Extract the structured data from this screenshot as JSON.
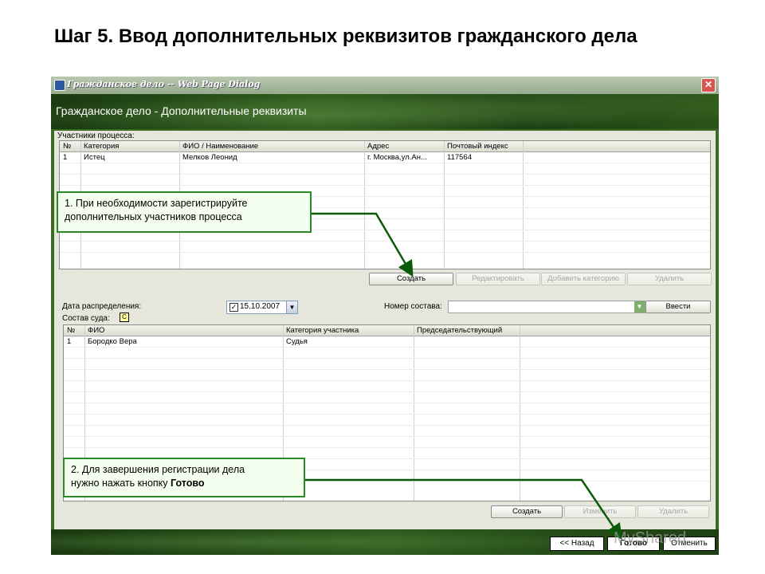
{
  "slide": {
    "title": "Шаг 5. Ввод дополнительных реквизитов гражданского дела"
  },
  "window": {
    "title": "Гражданское дело -- Web Page Dialog",
    "header": "Гражданское дело - Дополнительные реквизиты",
    "close_glyph": "✕"
  },
  "participants": {
    "label": "Участники процесса:",
    "columns": [
      "№",
      "Категория",
      "ФИО / Наименование",
      "Адрес",
      "Почтовый индекс"
    ],
    "rows": [
      [
        "1",
        "Истец",
        "Мелков Леонид",
        "г. Москва,ул.Ан...",
        "117564"
      ]
    ],
    "buttons": {
      "create": "Создать",
      "edit": "Редактировать",
      "add_category": "Добавить категорию",
      "delete": "Удалить"
    }
  },
  "distribution": {
    "date_label": "Дата распределения:",
    "date_checked": "✓",
    "date_value": "15.10.2007",
    "composition_label": "Номер состава:",
    "composition_value": "",
    "enter_button": "Ввести",
    "dropdown_glyph": "▼"
  },
  "court": {
    "label": "Состав суда:",
    "badge": "С",
    "columns": [
      "№",
      "ФИО",
      "Категория участника",
      "Председательствующий"
    ],
    "rows": [
      [
        "1",
        "Бородко Вера",
        "Судья",
        ""
      ]
    ],
    "buttons": {
      "create": "Создать",
      "edit": "Изменить",
      "delete": "Удалить"
    }
  },
  "footer": {
    "back": "<< Назад",
    "done": "Готово",
    "cancel": "Отменить"
  },
  "callouts": {
    "one_line1": "1. При необходимости зарегистрируйте",
    "one_line2": "дополнительных участников процесса",
    "two_line1": "2. Для завершения регистрации дела",
    "two_line2_prefix": "нужно нажать кнопку ",
    "two_line2_bold": "Готово"
  },
  "watermark": "MyShared",
  "colors": {
    "callout_border": "#2a8a2a",
    "callout_arrow": "#0a5a0a",
    "window_green": "#2d5a1c"
  }
}
